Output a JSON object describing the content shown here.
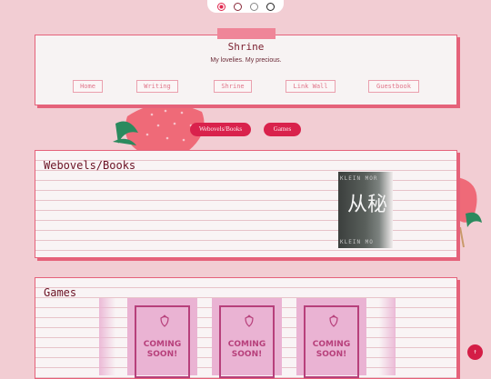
{
  "pager": {
    "count": 4
  },
  "header": {
    "title": "Shrine",
    "subtitle": "My lovelies. My precious.",
    "nav": [
      "Home",
      "Writing",
      "Shrine",
      "Link Wall",
      "Guestbook"
    ]
  },
  "categories": [
    "Webovels/Books",
    "Games"
  ],
  "sections": {
    "books": {
      "title": "Webovels/Books",
      "cover": {
        "glyphs": "从秘",
        "author_top": "KLEIN MOR",
        "author_bottom": "KLEIN MO"
      }
    },
    "games": {
      "title": "Games",
      "placeholder_lines": [
        "COMING",
        "SOON!"
      ]
    }
  },
  "scroll_top": {
    "label": "↑"
  },
  "colors": {
    "accent": "#d9224c",
    "border": "#e5627a",
    "background": "#f2cdd3"
  }
}
